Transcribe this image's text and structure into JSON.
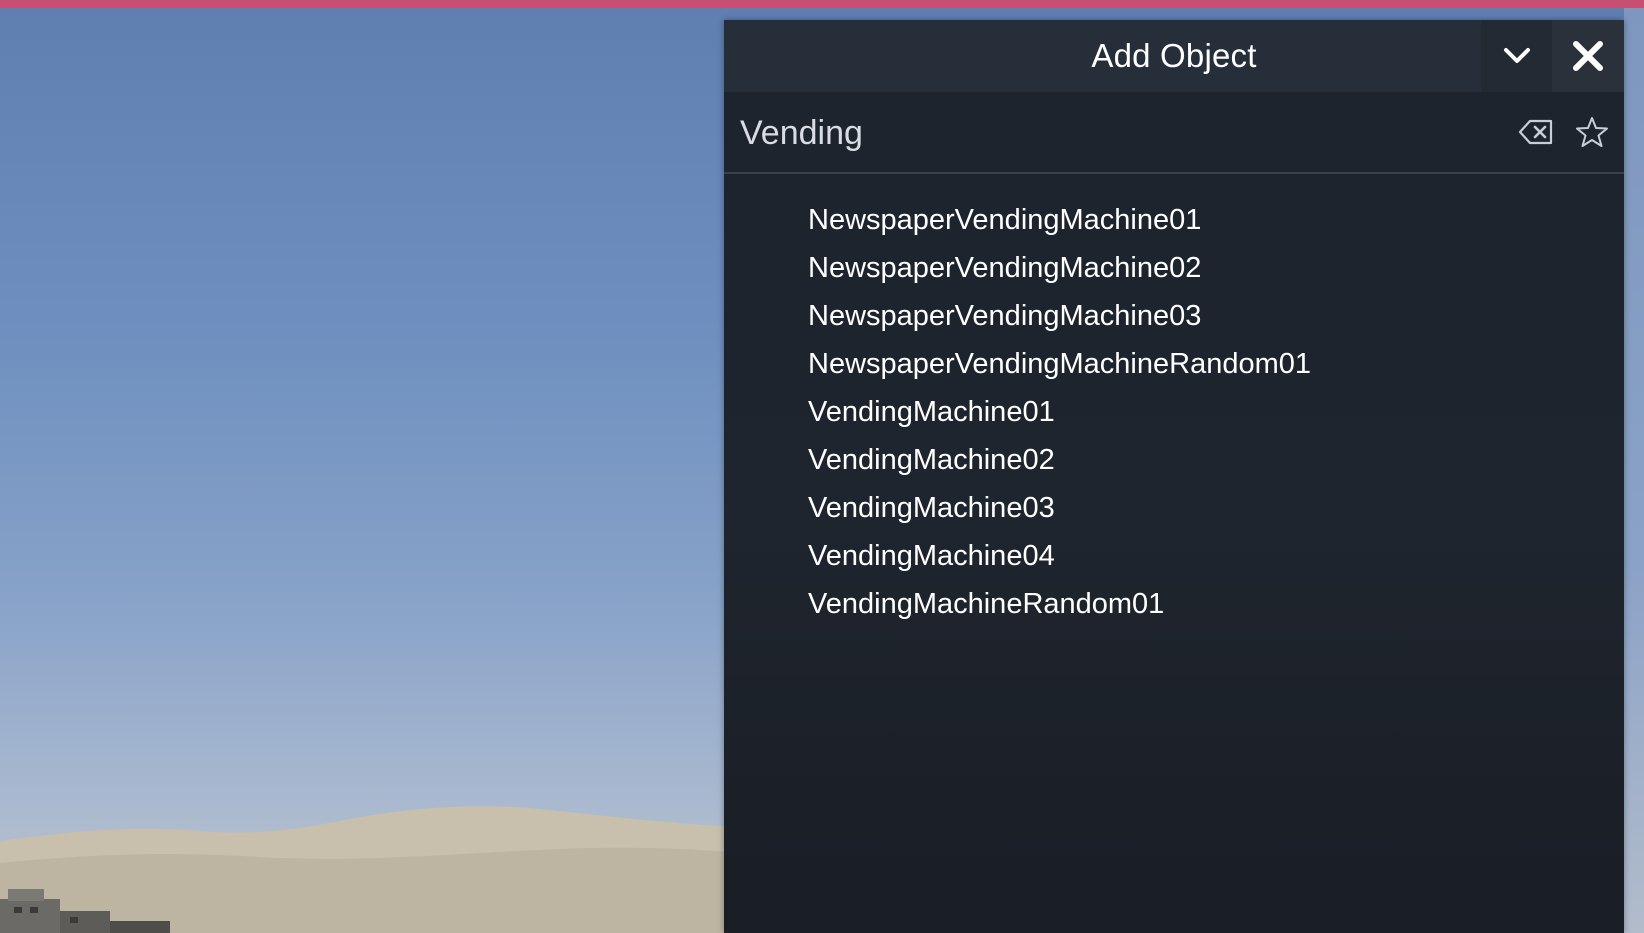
{
  "panel": {
    "title": "Add Object",
    "collapse_icon": "chevron-down-icon",
    "close_icon": "close-icon"
  },
  "search": {
    "value": "Vending",
    "placeholder": "",
    "clear_icon": "backspace-clear-icon",
    "favorite_icon": "star-outline-icon"
  },
  "results": [
    "NewspaperVendingMachine01",
    "NewspaperVendingMachine02",
    "NewspaperVendingMachine03",
    "NewspaperVendingMachineRandom01",
    "VendingMachine01",
    "VendingMachine02",
    "VendingMachine03",
    "VendingMachine04",
    "VendingMachineRandom01"
  ],
  "colors": {
    "panel_bg": "#1f252e",
    "titlebar_bg": "#262e39",
    "text": "#ffffff",
    "top_border": "#c64f72",
    "sky": "#6e8fbf"
  }
}
